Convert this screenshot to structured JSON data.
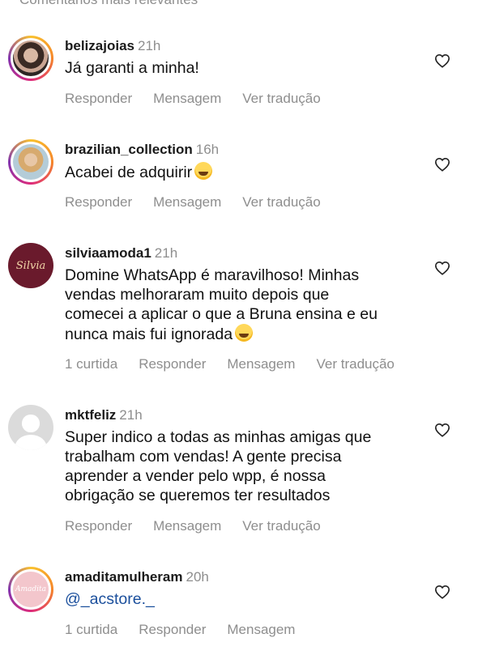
{
  "header": {
    "section_label": "Comentários mais relevantes"
  },
  "comments": [
    {
      "username": "belizajoias",
      "time": "21h",
      "text_lines": [
        "Já garanti a minha!"
      ],
      "actions": {
        "respond": "Responder",
        "message": "Mensagem",
        "translate": "Ver tradução"
      }
    },
    {
      "username": "brazilian_collection",
      "time": "16h",
      "text_lines": [
        "Acabei de adquirir"
      ],
      "emoji": "star-struck-emoji",
      "actions": {
        "respond": "Responder",
        "message": "Mensagem",
        "translate": "Ver tradução"
      }
    },
    {
      "username": "silviaamoda1",
      "time": "21h",
      "avatar_text": "Silvia",
      "text_lines": [
        "Domine WhatsApp é maravilhoso! Minhas",
        "vendas melhoraram muito depois que",
        "comecei a aplicar o que a Bruna ensina e eu",
        "nunca mais fui ignorada"
      ],
      "emoji": "tears-of-joy-emoji",
      "likes": "1 curtida",
      "actions": {
        "respond": "Responder",
        "message": "Mensagem",
        "translate": "Ver tradução"
      }
    },
    {
      "username": "mktfeliz",
      "time": "21h",
      "text_lines": [
        "Super indico a todas as minhas amigas que",
        "trabalham com vendas! A gente precisa",
        "aprender a vender pelo wpp, é nossa",
        "obrigação se queremos ter resultados"
      ],
      "actions": {
        "respond": "Responder",
        "message": "Mensagem",
        "translate": "Ver tradução"
      }
    },
    {
      "username": "amaditamulheram",
      "time": "20h",
      "avatar_text": "Amadita",
      "text_lines": [
        "@_acstore._"
      ],
      "likes": "1 curtida",
      "actions": {
        "respond": "Responder",
        "message": "Mensagem"
      }
    }
  ],
  "icons": {
    "like": "heart-outline-icon"
  },
  "colors": {
    "secondary_text": "#8e8e8e",
    "mention": "#1b4f9c",
    "story_ring": "#dd2a7b"
  }
}
